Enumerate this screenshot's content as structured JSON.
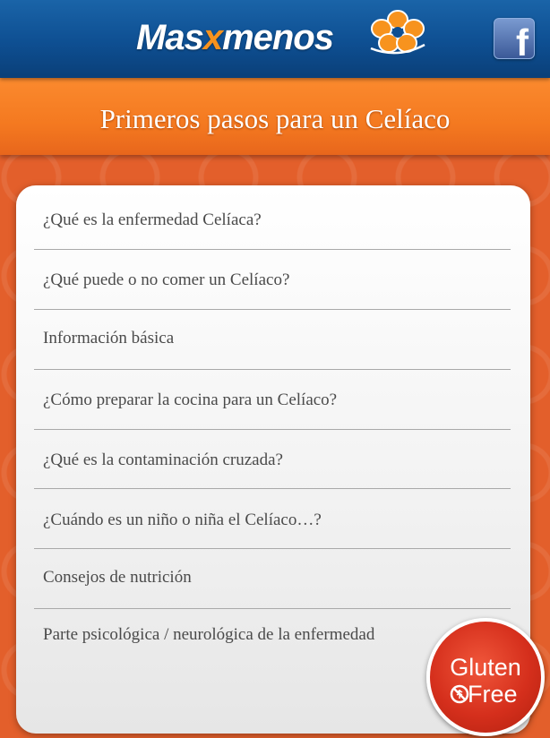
{
  "header": {
    "brand_left": "Mas",
    "brand_x": "x",
    "brand_right": "menos",
    "facebook_label": "f"
  },
  "title": "Primeros pasos para un Celíaco",
  "menu": {
    "items": [
      {
        "label": "¿Qué es la enfermedad Celíaca?"
      },
      {
        "label": "¿Qué puede o no comer un Celíaco?"
      },
      {
        "label": "Información básica"
      },
      {
        "label": "¿Cómo preparar la cocina para un Celíaco?"
      },
      {
        "label": "¿Qué es la contaminación cruzada?"
      },
      {
        "label": "¿Cuándo es un niño o niña el Celíaco…?"
      },
      {
        "label": "Consejos de nutrición"
      },
      {
        "label": "Parte psicológica / neurológica de la enfermedad"
      }
    ]
  },
  "badge": {
    "line1": "Gluten",
    "line2": "Free"
  },
  "colors": {
    "header_blue": "#0e4f92",
    "title_orange": "#f47920",
    "badge_red": "#d52f1c",
    "text_gray": "#4a4a4a"
  }
}
